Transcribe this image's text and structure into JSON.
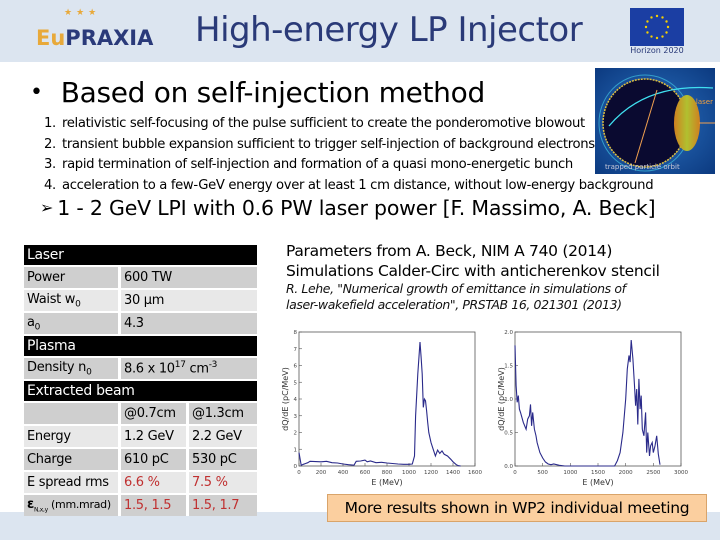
{
  "header": {
    "title": "High-energy LP Injector",
    "logo": {
      "eu": "Eu",
      "rest": "PRAXIA",
      "stars": "★★★"
    },
    "funding_label": "Horizon 2020"
  },
  "main_bullet": "Based on self-injection method",
  "numbered_list": [
    {
      "num": "1.",
      "text": "relativistic self-focusing of the pulse sufficient to create the ponderomotive blowout"
    },
    {
      "num": "2.",
      "text": "transient bubble expansion sufficient to trigger self-injection of background electrons"
    },
    {
      "num": "3.",
      "text": "rapid termination of self-injection and formation of a quasi mono-energetic bunch"
    },
    {
      "num": "4.",
      "text": "acceleration to a few-GeV energy over at least 1 cm distance, without low-energy background"
    }
  ],
  "illustration": {
    "caption": "trapped particle orbit",
    "laser_label": "laser"
  },
  "sub_bullet": "1 - 2 GeV LPI with 0.6 PW laser power [F. Massimo, A. Beck]",
  "params_table": {
    "laser": {
      "title": "Laser",
      "rows": [
        {
          "label": "Power",
          "value": "600 TW"
        },
        {
          "label": "Waist w",
          "sub": "0",
          "value": "30 µm"
        },
        {
          "label": "a",
          "sub": "0",
          "value": "4.3"
        }
      ]
    },
    "plasma": {
      "title": "Plasma",
      "rows": [
        {
          "label": "Density n",
          "sub": "0",
          "value_pre": "8.6 x 10",
          "value_sup": "17",
          "value_post": " cm",
          "value_sup2": "-3"
        }
      ]
    },
    "beam": {
      "title": "Extracted beam",
      "columns": [
        "@0.7cm",
        "@1.3cm"
      ],
      "rows": [
        {
          "label": "Energy",
          "values": [
            "1.2 GeV",
            "2.2 GeV"
          ]
        },
        {
          "label": "Charge",
          "values": [
            "610 pC",
            "530 pC"
          ]
        },
        {
          "label": "E spread rms",
          "values": [
            "6.6 %",
            "7.5 %"
          ]
        },
        {
          "label_symbol": "ε",
          "label_sub": "N,x,y",
          "label": " (mm.mrad)",
          "values": [
            "1.5, 1.5",
            "1.5, 1.7"
          ]
        }
      ],
      "highlight_color": "#c03030"
    }
  },
  "references": {
    "line1": "Parameters from A. Beck, NIM A 740 (2014)",
    "line2": "Simulations Calder-Circ with anticherenkov stencil",
    "citation1": "R. Lehe, \"Numerical growth of emittance in simulations of",
    "citation2": "laser-wakefield acceleration\", PRSTAB 16, 021301 (2013)"
  },
  "note": "More results shown in WP2 individual meeting",
  "chart_data": [
    {
      "type": "line",
      "title": "",
      "xlabel": "E (MeV)",
      "ylabel": "dQ/dE (pC/MeV)",
      "xlim": [
        0,
        1600
      ],
      "ylim": [
        0,
        8
      ],
      "xticks": [
        0,
        200,
        400,
        600,
        800,
        1000,
        1200,
        1400,
        1600
      ],
      "yticks": [
        0,
        1,
        2,
        3,
        4,
        5,
        6,
        7,
        8
      ],
      "grid": false,
      "series": [
        {
          "name": "@0.7cm",
          "color": "#2a2a8a",
          "x": [
            0,
            20,
            40,
            60,
            80,
            100,
            150,
            200,
            250,
            300,
            350,
            400,
            450,
            500,
            520,
            560,
            600,
            620,
            650,
            700,
            750,
            800,
            850,
            900,
            950,
            1000,
            1030,
            1050,
            1060,
            1080,
            1100,
            1110,
            1120,
            1130,
            1140,
            1150,
            1160,
            1170,
            1180,
            1200,
            1220,
            1240,
            1260,
            1280,
            1300,
            1320,
            1350,
            1380,
            1400,
            1430,
            1450,
            1470
          ],
          "y": [
            0.8,
            0.05,
            0.1,
            0.15,
            0.2,
            0.28,
            0.26,
            0.25,
            0.28,
            0.2,
            0.18,
            0.12,
            0.08,
            0.05,
            0.28,
            0.3,
            0.35,
            0.25,
            0.3,
            0.2,
            0.22,
            0.18,
            0.15,
            0.12,
            0.1,
            0.1,
            0.12,
            0.6,
            3.0,
            5.5,
            7.4,
            6.5,
            5.5,
            3.5,
            4.0,
            3.9,
            3.3,
            2.6,
            2.0,
            1.4,
            1.0,
            0.6,
            0.95,
            0.75,
            0.9,
            0.7,
            0.6,
            0.4,
            0.25,
            0.08,
            0.02,
            0.0
          ]
        }
      ]
    },
    {
      "type": "line",
      "title": "",
      "xlabel": "E (MeV)",
      "ylabel": "dQ/dE (pC/MeV)",
      "xlim": [
        0,
        3000
      ],
      "ylim": [
        0,
        2.0
      ],
      "xticks": [
        0,
        500,
        1000,
        1500,
        2000,
        2500,
        3000
      ],
      "yticks": [
        0.0,
        0.5,
        1.0,
        1.5,
        2.0
      ],
      "grid": false,
      "series": [
        {
          "name": "@1.3cm",
          "color": "#2a2a8a",
          "x": [
            0,
            20,
            40,
            60,
            80,
            100,
            150,
            200,
            230,
            260,
            280,
            300,
            320,
            350,
            380,
            400,
            450,
            500,
            550,
            600,
            650,
            700,
            800,
            900,
            1000,
            1500,
            1800,
            1850,
            1900,
            1950,
            2000,
            2030,
            2060,
            2080,
            2100,
            2130,
            2160,
            2180,
            2200,
            2220,
            2240,
            2260,
            2280,
            2300,
            2330,
            2360,
            2380,
            2400,
            2430,
            2450,
            2480,
            2500,
            2530,
            2560,
            2590,
            2620
          ],
          "y": [
            1.8,
            1.2,
            0.95,
            1.05,
            0.85,
            0.8,
            0.65,
            0.55,
            0.7,
            0.75,
            0.92,
            0.6,
            0.8,
            0.55,
            0.45,
            0.35,
            0.2,
            0.12,
            0.06,
            0.03,
            0.02,
            0.03,
            0.01,
            0.0,
            0.0,
            0.0,
            0.0,
            0.08,
            0.2,
            0.5,
            1.0,
            1.45,
            1.65,
            1.55,
            1.88,
            1.6,
            1.2,
            0.9,
            1.15,
            0.62,
            1.3,
            0.85,
            1.05,
            0.55,
            0.45,
            0.8,
            0.2,
            0.5,
            0.15,
            0.3,
            0.35,
            0.2,
            0.3,
            0.45,
            0.18,
            0.02
          ]
        }
      ]
    }
  ]
}
